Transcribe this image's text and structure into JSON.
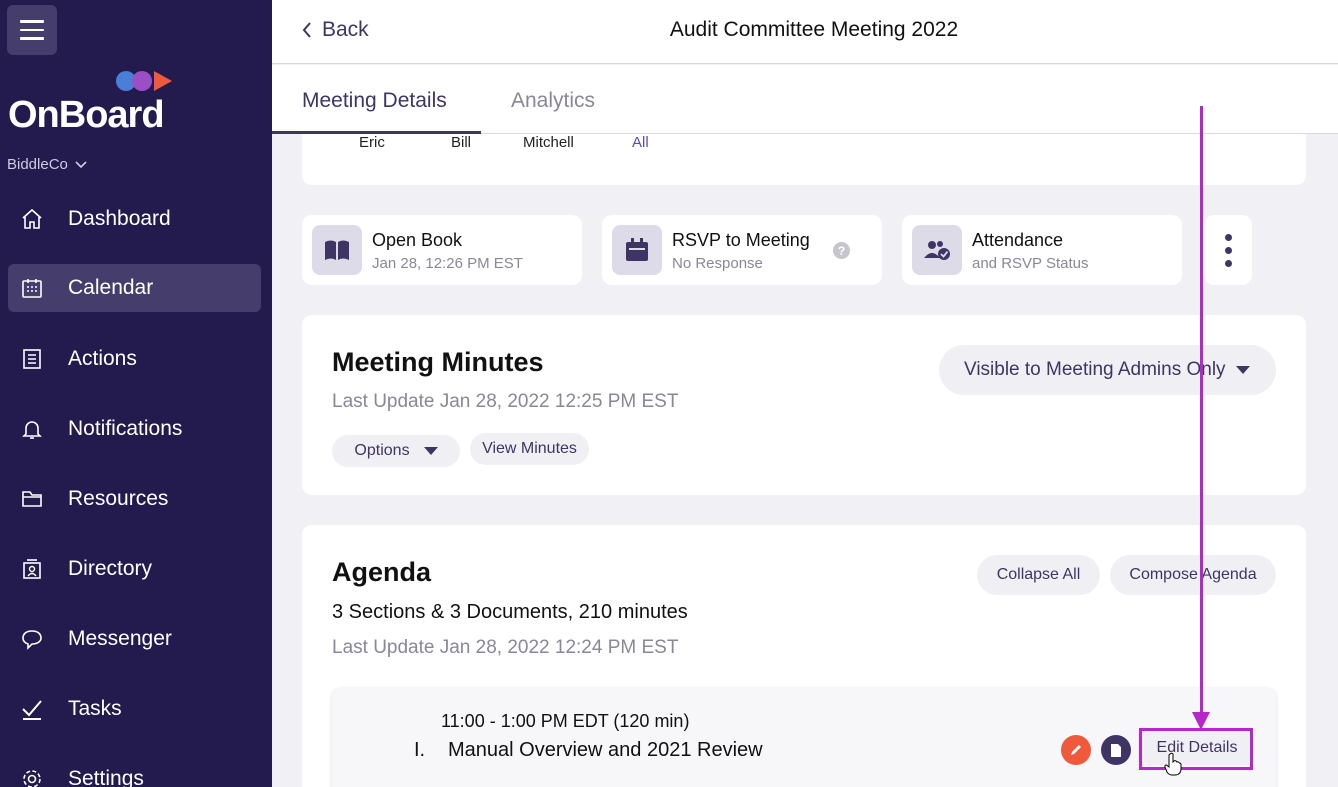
{
  "sidebar": {
    "brand": "OnBoard",
    "brand_colors": [
      "#4a7fd6",
      "#9b4fc7",
      "#f05a3c"
    ],
    "org": "BiddleCo",
    "items": [
      {
        "label": "Dashboard",
        "icon": "home-icon"
      },
      {
        "label": "Calendar",
        "icon": "calendar-icon",
        "active": true
      },
      {
        "label": "Actions",
        "icon": "checklist-icon"
      },
      {
        "label": "Notifications",
        "icon": "bell-icon"
      },
      {
        "label": "Resources",
        "icon": "folder-icon"
      },
      {
        "label": "Directory",
        "icon": "directory-icon"
      },
      {
        "label": "Messenger",
        "icon": "chat-icon"
      },
      {
        "label": "Tasks",
        "icon": "check-icon"
      },
      {
        "label": "Settings",
        "icon": "gear-icon"
      }
    ]
  },
  "header": {
    "back_label": "Back",
    "title": "Audit Committee Meeting 2022"
  },
  "tabs": [
    {
      "label": "Meeting Details",
      "active": true
    },
    {
      "label": "Analytics",
      "active": false
    }
  ],
  "attendees": {
    "names": [
      "Eric",
      "Bill",
      "Mitchell"
    ],
    "all_label": "All"
  },
  "quick": {
    "book": {
      "title": "Open Book",
      "sub": "Jan 28, 12:26 PM EST"
    },
    "rsvp": {
      "title": "RSVP to Meeting",
      "sub": "No Response",
      "help": "?"
    },
    "attendance": {
      "title": "Attendance",
      "sub": "and RSVP Status"
    }
  },
  "minutes": {
    "title": "Meeting Minutes",
    "updated": "Last Update Jan 28, 2022 12:25 PM EST",
    "visibility": "Visible to Meeting Admins Only",
    "options_label": "Options",
    "view_label": "View Minutes"
  },
  "agenda": {
    "title": "Agenda",
    "stats": "3 Sections & 3 Documents, 210 minutes",
    "updated": "Last Update Jan 28, 2022 12:24 PM EST",
    "collapse_label": "Collapse All",
    "compose_label": "Compose Agenda",
    "item": {
      "time": "11:00 - 1:00 PM EDT (120 min)",
      "number": "I.",
      "title": "Manual Overview and 2021 Review",
      "edit_label": "Edit Details"
    }
  },
  "colors": {
    "sidebar_bg": "#231a4e",
    "accent": "#3f3565",
    "annotation": "#b626c9",
    "pencil": "#f05a3c"
  }
}
